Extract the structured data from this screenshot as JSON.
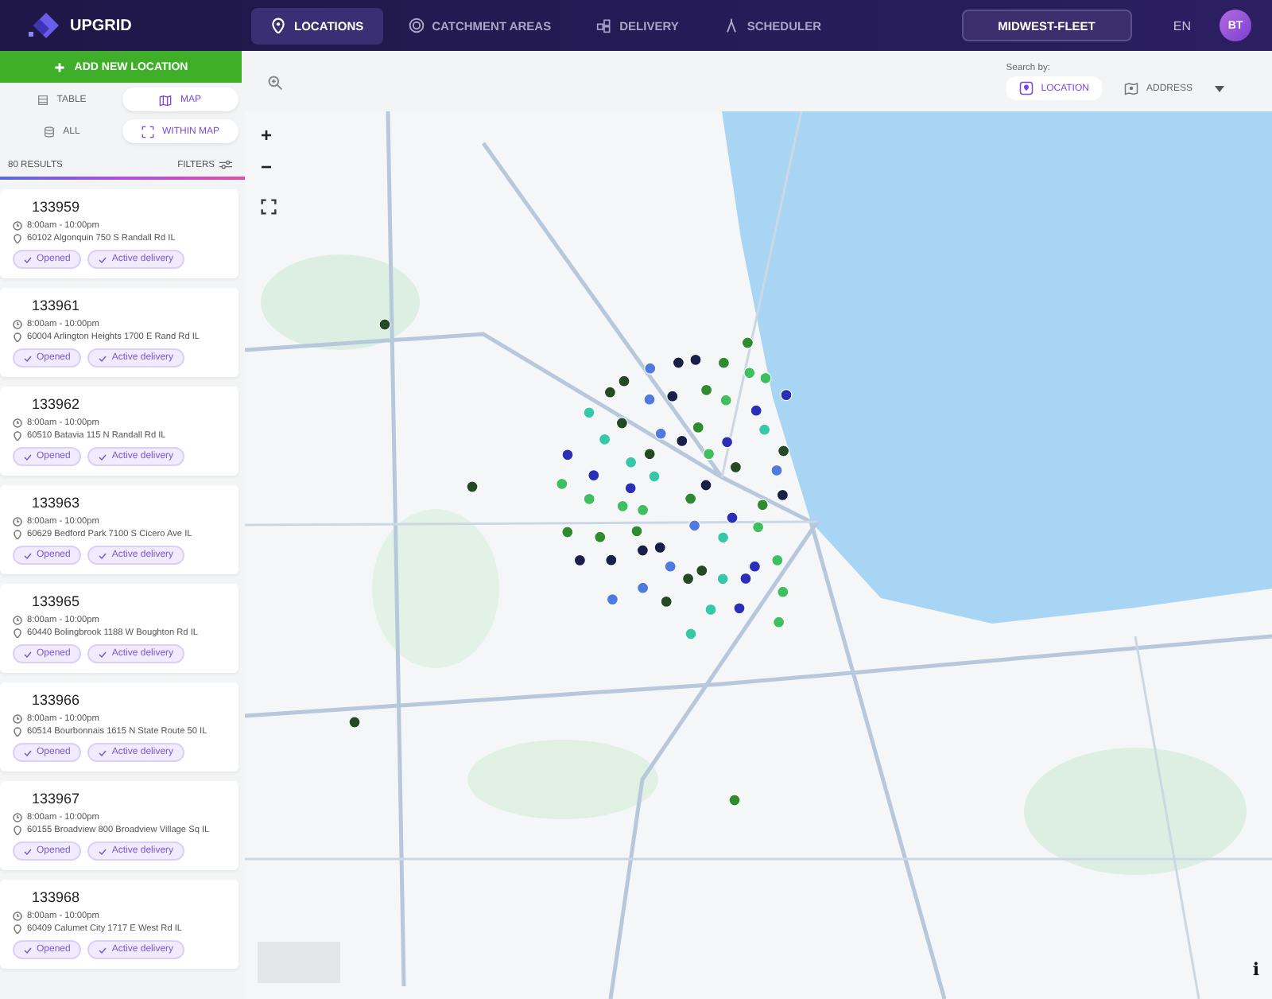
{
  "header": {
    "brand": "UPGRID",
    "nav": [
      {
        "label": "LOCATIONS",
        "selected": true
      },
      {
        "label": "CATCHMENT AREAS",
        "selected": false
      },
      {
        "label": "DELIVERY",
        "selected": false
      },
      {
        "label": "SCHEDULER",
        "selected": false
      }
    ],
    "fleet": "MIDWEST-FLEET",
    "language": "EN",
    "avatar": "BT"
  },
  "sidebar": {
    "add_button": "ADD NEW LOCATION",
    "view_toggle": [
      {
        "label": "TABLE",
        "selected": false
      },
      {
        "label": "MAP",
        "selected": true
      }
    ],
    "scope_toggle": [
      {
        "label": "ALL",
        "selected": false
      },
      {
        "label": "WITHIN MAP",
        "selected": true
      }
    ],
    "results": "80 RESULTS",
    "filters": "FILTERS",
    "locations": [
      {
        "id": "133959",
        "hours": "8:00am - 10:00pm",
        "address": "60102 Algonquin 750 S Randall Rd IL",
        "tags": [
          "Opened",
          "Active delivery"
        ]
      },
      {
        "id": "133961",
        "hours": "8:00am - 10:00pm",
        "address": "60004 Arlington Heights 1700 E Rand Rd IL",
        "tags": [
          "Opened",
          "Active delivery"
        ]
      },
      {
        "id": "133962",
        "hours": "8:00am - 10:00pm",
        "address": "60510 Batavia 115 N Randall Rd IL",
        "tags": [
          "Opened",
          "Active delivery"
        ]
      },
      {
        "id": "133963",
        "hours": "8:00am - 10:00pm",
        "address": "60629 Bedford Park 7100 S Cicero Ave IL",
        "tags": [
          "Opened",
          "Active delivery"
        ]
      },
      {
        "id": "133965",
        "hours": "8:00am - 10:00pm",
        "address": "60440 Bolingbrook 1188 W Boughton Rd IL",
        "tags": [
          "Opened",
          "Active delivery"
        ]
      },
      {
        "id": "133966",
        "hours": "8:00am - 10:00pm",
        "address": "60514 Bourbonnais 1615 N State Route 50 IL",
        "tags": [
          "Opened",
          "Active delivery"
        ]
      },
      {
        "id": "133967",
        "hours": "8:00am - 10:00pm",
        "address": "60155 Broadview 800 Broadview Village Sq IL",
        "tags": [
          "Opened",
          "Active delivery"
        ]
      },
      {
        "id": "133968",
        "hours": "8:00am - 10:00pm",
        "address": "60409 Calumet City 1717 E West Rd IL",
        "tags": [
          "Opened",
          "Active delivery"
        ]
      }
    ]
  },
  "search_by": {
    "label": "Search by:",
    "options": [
      {
        "label": "LOCATION",
        "selected": true
      },
      {
        "label": "ADDRESS",
        "selected": false
      }
    ]
  },
  "map": {
    "kind": "picture",
    "zoom_in": "+",
    "zoom_out": "−",
    "info": "i"
  }
}
